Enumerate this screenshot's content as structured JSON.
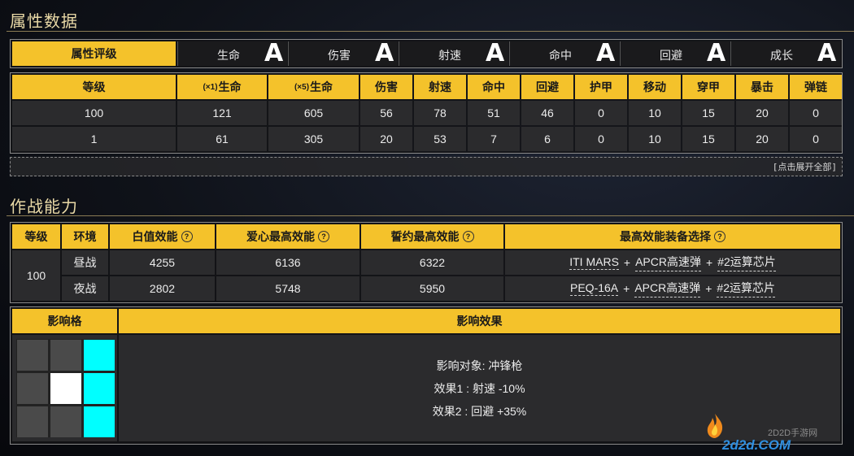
{
  "attr_section": {
    "title": "属性数据",
    "rating_header": "属性评级",
    "ratings": [
      {
        "label": "生命",
        "grade": "A"
      },
      {
        "label": "伤害",
        "grade": "A"
      },
      {
        "label": "射速",
        "grade": "A"
      },
      {
        "label": "命中",
        "grade": "A"
      },
      {
        "label": "回避",
        "grade": "A"
      },
      {
        "label": "成长",
        "grade": "A"
      }
    ],
    "stat_headers": [
      "等级",
      "生命",
      "生命",
      "伤害",
      "射速",
      "命中",
      "回避",
      "护甲",
      "移动",
      "穿甲",
      "暴击",
      "弹链"
    ],
    "hp_prefix_1": "(×1)",
    "hp_prefix_5": "(×5)",
    "rows": [
      [
        "100",
        "121",
        "605",
        "56",
        "78",
        "51",
        "46",
        "0",
        "10",
        "15",
        "20",
        "0"
      ],
      [
        "1",
        "61",
        "305",
        "20",
        "53",
        "7",
        "6",
        "0",
        "10",
        "15",
        "20",
        "0"
      ]
    ],
    "expand_label": "[点击展开全部]"
  },
  "combat_section": {
    "title": "作战能力",
    "headers": {
      "level": "等级",
      "env": "环境",
      "base": "白值效能",
      "love": "爱心最高效能",
      "oath": "誓约最高效能",
      "equip": "最高效能装备选择"
    },
    "help_icon": "?",
    "level": "100",
    "rows": [
      {
        "env": "昼战",
        "base": "4255",
        "love": "6136",
        "oath": "6322",
        "equip": [
          "ITI MARS",
          "APCR高速弹",
          "#2运算芯片"
        ]
      },
      {
        "env": "夜战",
        "base": "2802",
        "love": "5748",
        "oath": "5950",
        "equip": [
          "PEQ-16A",
          "APCR高速弹",
          "#2运算芯片"
        ]
      }
    ],
    "plus": "+"
  },
  "influence": {
    "grid_header": "影响格",
    "effect_header": "影响效果",
    "grid": [
      [
        "gray",
        "gray",
        "cyan"
      ],
      [
        "gray",
        "white",
        "cyan"
      ],
      [
        "gray",
        "gray",
        "cyan"
      ]
    ],
    "target": "影响对象: 冲锋枪",
    "effect1": "效果1 : 射速 -10%",
    "effect2": "效果2 : 回避 +35%"
  },
  "watermark": {
    "line1": "2D2D手游网",
    "line2": "2d2d.COM"
  },
  "colors": {
    "accent": "#f4c22b",
    "cyan": "#00ffff",
    "panel": "#2b2b2d"
  }
}
